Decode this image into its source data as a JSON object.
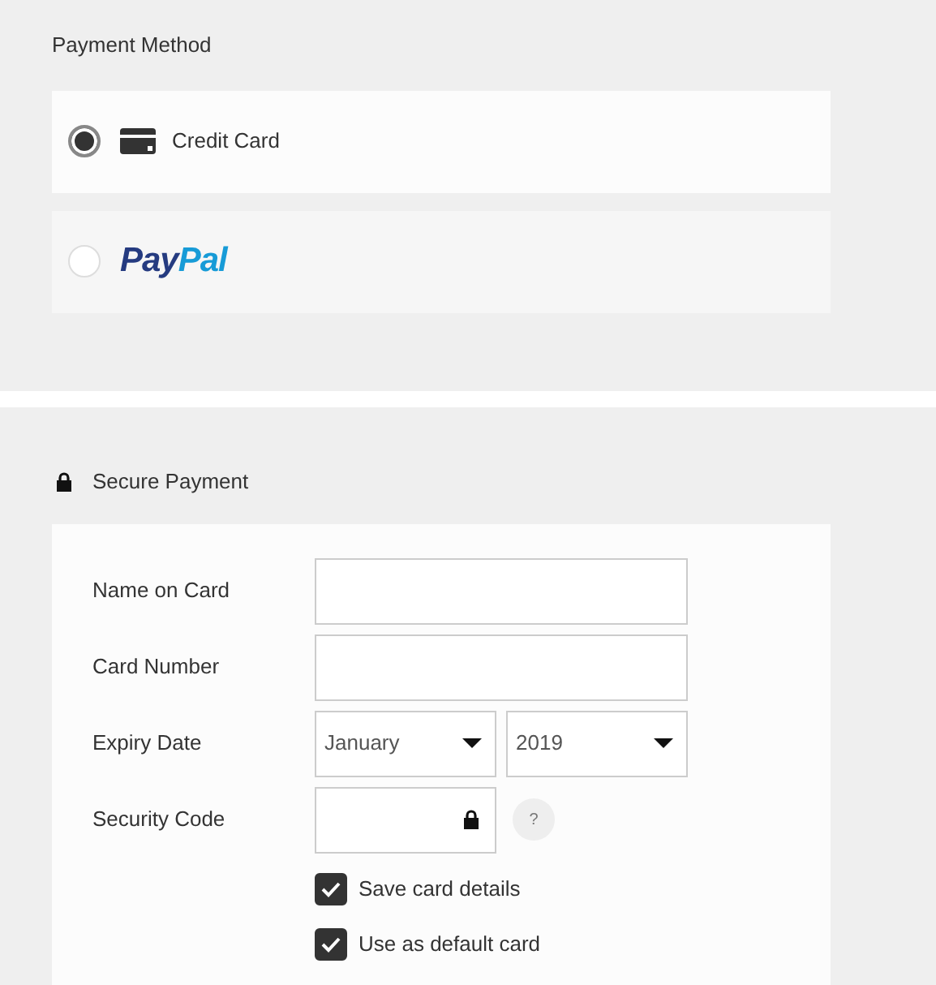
{
  "payment_method": {
    "title": "Payment Method",
    "options": [
      {
        "kind": "card",
        "label": "Credit Card",
        "selected": true
      },
      {
        "kind": "paypal",
        "logo_parts": [
          {
            "text": "Pay",
            "color": "#253b80"
          },
          {
            "text": "Pal",
            "color": "#179bd7"
          }
        ],
        "selected": false
      }
    ]
  },
  "secure_payment": {
    "title": "Secure Payment",
    "fields": [
      {
        "kind": "text",
        "label": "Name on Card"
      },
      {
        "kind": "text",
        "label": "Card Number"
      },
      {
        "kind": "selects",
        "label": "Expiry Date",
        "values": [
          "January",
          "2019"
        ]
      },
      {
        "kind": "secure",
        "label": "Security Code",
        "help": "?"
      }
    ],
    "checkboxes": [
      {
        "label": "Save card details",
        "checked": true
      },
      {
        "label": "Use as default card",
        "checked": true
      }
    ]
  }
}
